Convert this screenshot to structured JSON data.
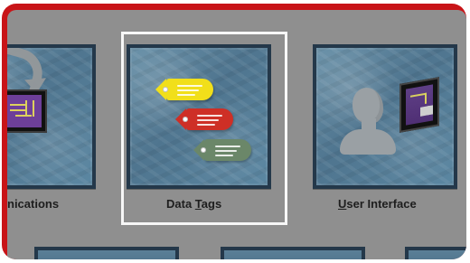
{
  "items": [
    {
      "label": "nications"
    },
    {
      "label_prefix": "Data ",
      "label_mnemonic": "T",
      "label_suffix": "ags"
    },
    {
      "label_mnemonic": "U",
      "label_suffix": "ser Interface"
    }
  ],
  "colors": {
    "frame": "#c81418",
    "background": "#8f8f8f",
    "tile_border": "#24384a",
    "selection_border": "#f7f7f7",
    "tag_yellow": "#f1df1a",
    "tag_red": "#ce2f26",
    "tag_green": "#6b8769"
  },
  "icons": {
    "communications": "communications-icon",
    "data_tags": "data-tags-icon",
    "user_interface": "user-interface-icon"
  }
}
